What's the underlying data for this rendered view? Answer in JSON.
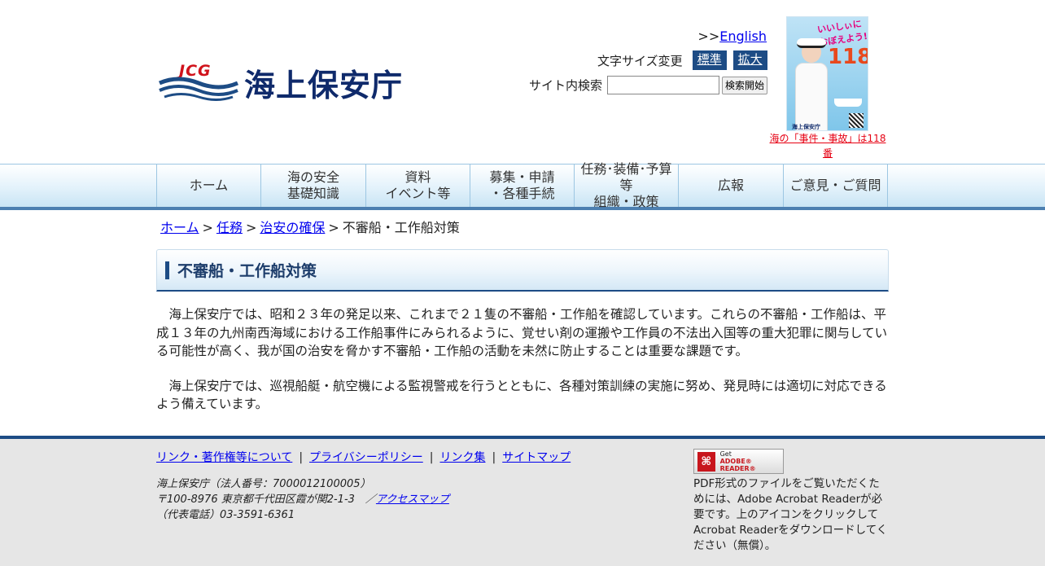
{
  "header": {
    "logo_abbr": "JCG",
    "logo_name": "海上保安庁",
    "english_prefix": ">>",
    "english_link": "English",
    "fontsize_label": "文字サイズ変更",
    "fontsize_standard": "標準",
    "fontsize_large": "拡大",
    "search_label": "サイト内検索",
    "search_value": "",
    "search_button": "検索開始",
    "banner_caption": "海の「事件・事故」は118番",
    "banner_title": "いいしぃにおぼえよう!",
    "banner_number": "118"
  },
  "nav": {
    "items": [
      {
        "line1": "ホーム",
        "line2": ""
      },
      {
        "line1": "海の安全",
        "line2": "基礎知識"
      },
      {
        "line1": "資料",
        "line2": "イベント等"
      },
      {
        "line1": "募集・申請",
        "line2": "・各種手続"
      },
      {
        "line1": "任務･装備･予算等",
        "line2": "組織・政策"
      },
      {
        "line1": "広報",
        "line2": ""
      },
      {
        "line1": "ご意見・ご質問",
        "line2": ""
      }
    ]
  },
  "breadcrumb": {
    "home": "ホーム",
    "mission": "任務",
    "security": "治安の確保",
    "current": "不審船・工作船対策",
    "sep": ">"
  },
  "main": {
    "title": "不審船・工作船対策",
    "para1": "海上保安庁では、昭和２３年の発足以来、これまで２１隻の不審船・工作船を確認しています。これらの不審船・工作船は、平成１３年の九州南西海域における工作船事件にみられるように、覚せい剤の運搬や工作員の不法出入国等の重大犯罪に関与している可能性が高く、我が国の治安を脅かす不審船・工作船の活動を未然に防止することは重要な課題です。",
    "para2": "海上保安庁では、巡視船艇・航空機による監視警戒を行うとともに、各種対策訓練の実施に努め、発見時には適切に対応できるよう備えています。"
  },
  "footer": {
    "links": [
      "リンク・著作権等について",
      "プライバシーポリシー",
      "リンク集",
      "サイトマップ"
    ],
    "pipe": "|",
    "org_line": "海上保安庁（法人番号：7000012100005）",
    "address": "〒100-8976 東京都千代田区霞が関2-1-3　／",
    "access_map": "アクセスマップ",
    "phone": "（代表電話）03-3591-6361",
    "adobe_get": "Get",
    "adobe_reader": "ADOBE® READER®",
    "pdf_note": "PDF形式のファイルをご覧いただくためには、Adobe Acrobat Readerが必要です。上のアイコンをクリックしてAcrobat Readerをダウンロードしてください（無償）。"
  },
  "colors": {
    "navy": "#1d4c85",
    "link": "#0000ee",
    "alert_red": "#e60012"
  }
}
